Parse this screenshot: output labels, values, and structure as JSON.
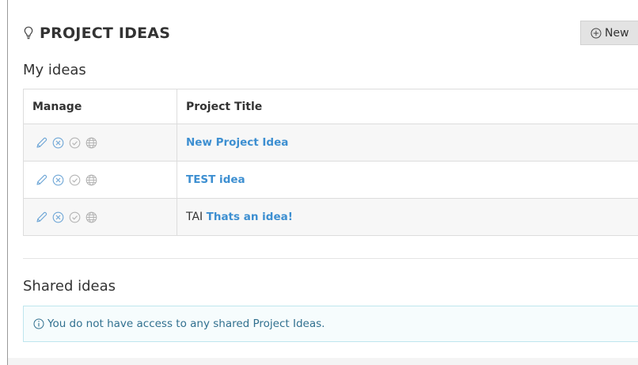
{
  "header": {
    "title": "PROJECT IDEAS",
    "icon": "lightbulb-icon",
    "new_button_label": "New"
  },
  "my_ideas": {
    "heading": "My ideas",
    "columns": [
      "Manage",
      "Project Title"
    ],
    "rows": [
      {
        "prefix": "",
        "title": "New Project Idea",
        "actions": [
          "edit-icon",
          "delete-icon",
          "approve-icon",
          "publish-icon"
        ]
      },
      {
        "prefix": "",
        "title": "TEST idea",
        "actions": [
          "edit-icon",
          "delete-icon",
          "approve-icon",
          "publish-icon"
        ]
      },
      {
        "prefix": "TAI",
        "title": "Thats an idea!",
        "actions": [
          "edit-icon",
          "delete-icon",
          "approve-icon",
          "publish-icon"
        ]
      }
    ]
  },
  "shared_ideas": {
    "heading": "Shared ideas",
    "notice": "You do not have access to any shared Project Ideas."
  },
  "colors": {
    "link": "#3d8fd1",
    "icon": "#6ea6d6",
    "notice_bg": "#f6fcfd",
    "notice_border": "#bfe6ee",
    "notice_text": "#31708f"
  }
}
